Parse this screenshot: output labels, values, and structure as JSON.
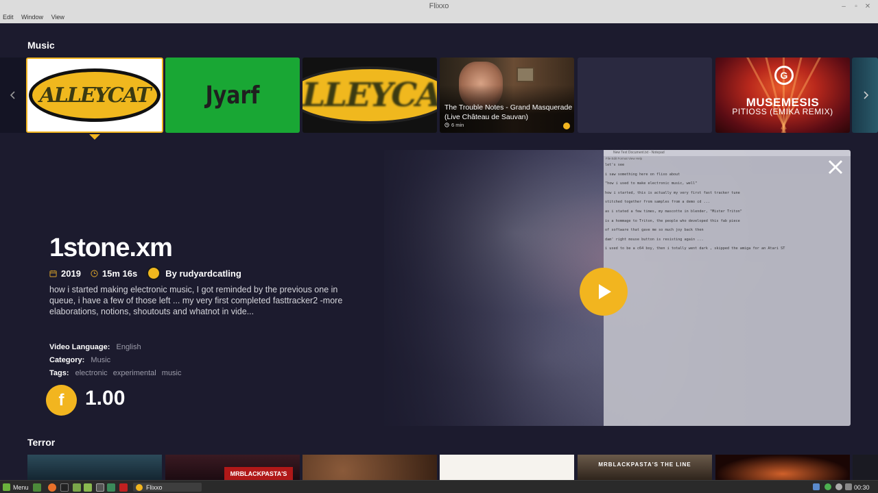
{
  "window": {
    "title": "Flixxo",
    "menu": [
      "Edit",
      "Window",
      "View"
    ],
    "controls": [
      "minimize-icon",
      "restore-icon",
      "close-icon"
    ]
  },
  "sections": {
    "music": "Music",
    "terror": "Terror"
  },
  "music_cards": [
    {
      "kind": "logo",
      "text": "ALLEYCAT",
      "selected": true
    },
    {
      "kind": "logo",
      "text": "Jyarf"
    },
    {
      "kind": "logo",
      "text": "ALLEYCAT"
    },
    {
      "kind": "video",
      "title": "The Trouble Notes - Grand Masquerade (Live Château de Sauvan)",
      "duration": "6 min"
    },
    {
      "kind": "empty"
    },
    {
      "kind": "video-art",
      "title": "MUSEMESIS",
      "subtitle": "PITIOSS (EMIKA REMIX)"
    }
  ],
  "detail": {
    "title": "1stone.xm",
    "year": "2019",
    "duration": "15m 16s",
    "author": "By rudyardcatling",
    "description": "how i started making electronic music, I got reminded by the previous one in queue, i have a few of those left ... my very first completed fasttracker2 -more elaborations, notions, shoutouts and whatnot in vide...",
    "language_label": "Video Language:",
    "language": "English",
    "category_label": "Category:",
    "category": "Music",
    "tags_label": "Tags:",
    "tags": [
      "electronic",
      "experimental",
      "music"
    ],
    "coin_symbol": "f",
    "price": "1.00"
  },
  "notepad": {
    "title": "New Text Document.txt - Notepad",
    "menu": "File   Edit   Format   View   Help",
    "lines": [
      "let's see",
      "i saw something here on flixo about",
      "\"how i used to make electronic music, well\"",
      "how i started, this is actually my very first fast tracker tune",
      "stitched together from samples from a demo cd ...",
      "as i stated a few times, my mascotte in blender, \"Mister Triton\"",
      "is a hommage to Triton, the people who developed this fab piece",
      "of software that gave me so much joy back then",
      "dam' right mouse button is resisting again ...",
      "i used to be a c64 boy, then i totally went dark , skipped the amiga for an Atari ST"
    ]
  },
  "terror_cards": [
    {
      "kind": "thumb"
    },
    {
      "kind": "thumb",
      "text": "MRBLACKPASTA'S"
    },
    {
      "kind": "thumb"
    },
    {
      "kind": "thumb"
    },
    {
      "kind": "thumb",
      "text": "MRBLACKPASTA'S THE LINE"
    },
    {
      "kind": "thumb"
    }
  ],
  "taskbar": {
    "menu_label": "Menu",
    "window_label": "Flixxo",
    "clock": "00:30"
  },
  "colors": {
    "accent": "#f2b51f",
    "background": "#1c1b2e",
    "card_placeholder": "#2a2940"
  }
}
